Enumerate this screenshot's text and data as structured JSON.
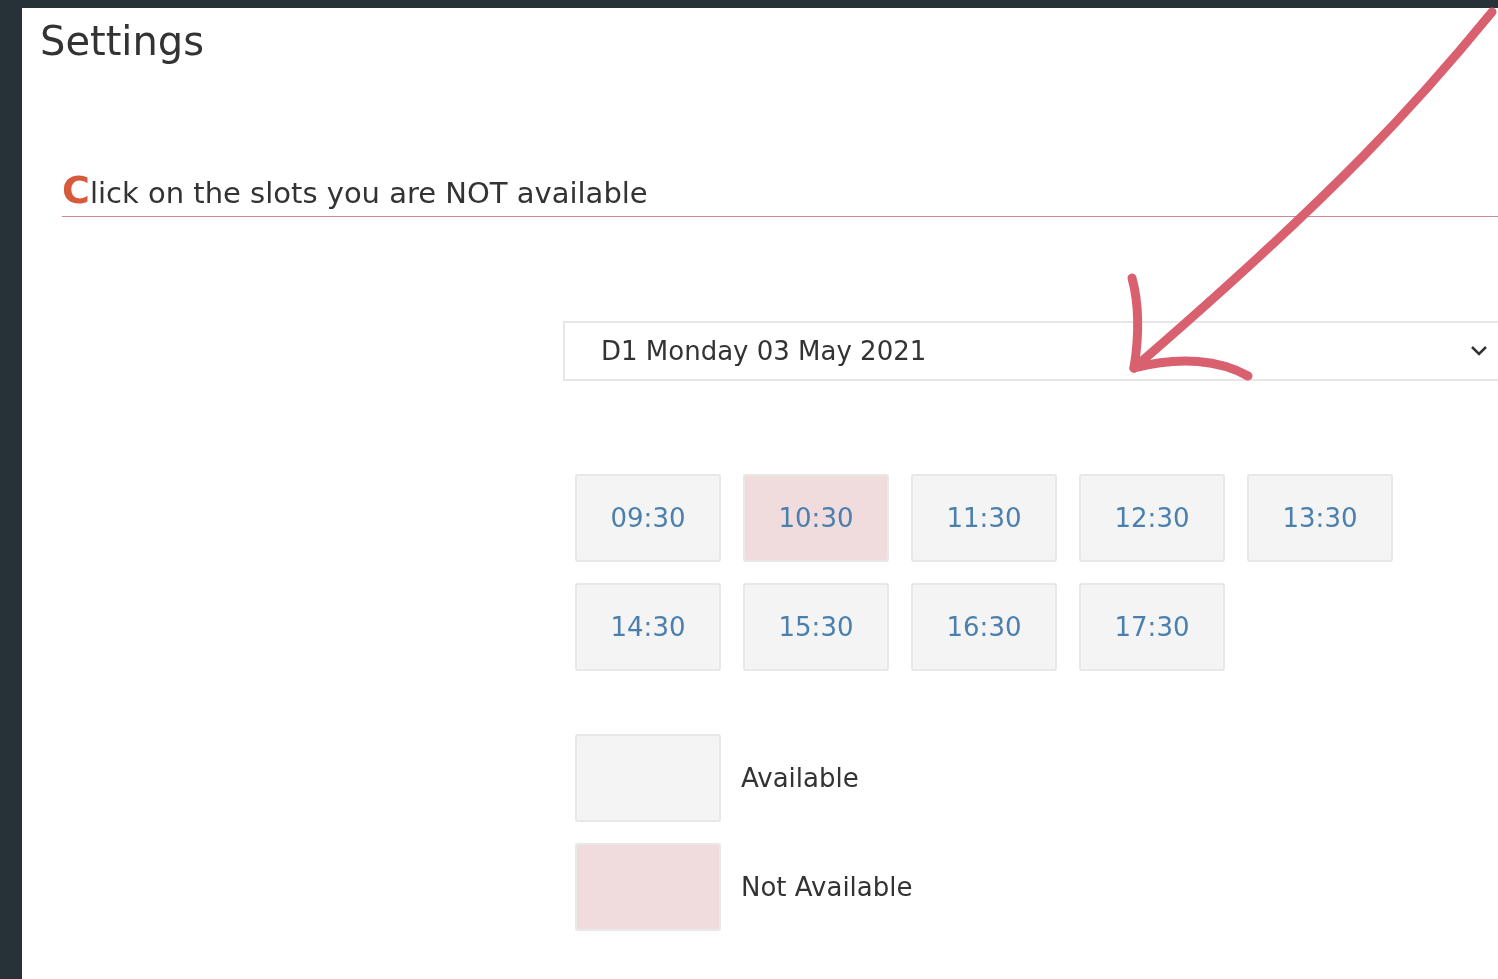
{
  "title": "Settings",
  "heading": "Click on the slots you are NOT available",
  "dropdown": {
    "value": "D1 Monday 03 May 2021"
  },
  "slots": [
    {
      "time": "09:30",
      "selected": false
    },
    {
      "time": "10:30",
      "selected": true
    },
    {
      "time": "11:30",
      "selected": false
    },
    {
      "time": "12:30",
      "selected": false
    },
    {
      "time": "13:30",
      "selected": false
    },
    {
      "time": "14:30",
      "selected": false
    },
    {
      "time": "15:30",
      "selected": false
    },
    {
      "time": "16:30",
      "selected": false
    },
    {
      "time": "17:30",
      "selected": false
    }
  ],
  "legend": [
    {
      "label": "Available",
      "kind": "available"
    },
    {
      "label": "Not Available",
      "kind": "unavailable"
    }
  ]
}
